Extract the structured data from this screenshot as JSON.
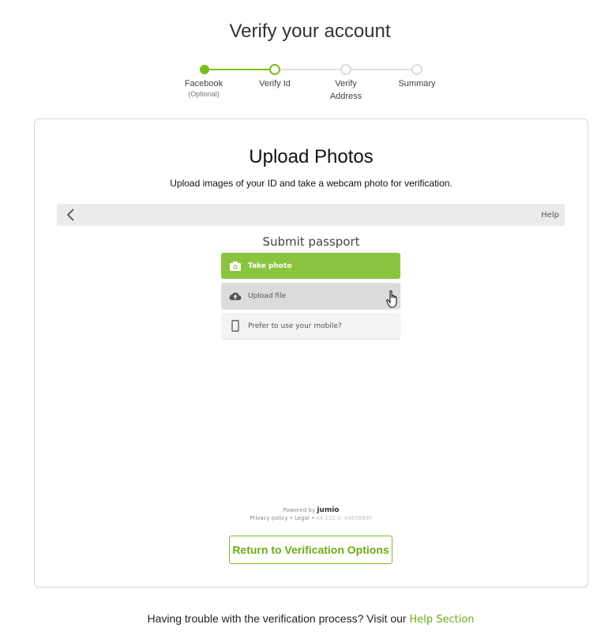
{
  "header": {
    "title": "Verify your account"
  },
  "stepper": {
    "accent": "#7cbd1e",
    "steps": [
      {
        "label": "Facebook",
        "sublabel": "(Optional)",
        "state": "done"
      },
      {
        "label": "Verify Id",
        "sublabel": "",
        "state": "current"
      },
      {
        "label": "Verify",
        "label2": "Address",
        "state": "pending"
      },
      {
        "label": "Summary",
        "sublabel": "",
        "state": "pending"
      }
    ]
  },
  "card": {
    "title": "Upload Photos",
    "subtitle": "Upload images of your ID and take a webcam photo for verification.",
    "embed": {
      "help_label": "Help",
      "back_icon": "chevron-left-icon",
      "heading": "Submit passport",
      "options": [
        {
          "label": "Take photo",
          "icon": "camera-icon"
        },
        {
          "label": "Upload file",
          "icon": "cloud-upload-icon"
        },
        {
          "label": "Prefer to use your mobile?",
          "icon": "mobile-phone-icon"
        }
      ],
      "powered_by": "Powered by",
      "brand": "jumio",
      "privacy_label": "Privacy policy",
      "legal_label": "Legal",
      "separator": "•",
      "version": "v4.122.0 -e4658697"
    },
    "return_button": "Return to Verification Options"
  },
  "footer": {
    "text": "Having trouble with the verification process? Visit our",
    "link": "Help Section"
  }
}
